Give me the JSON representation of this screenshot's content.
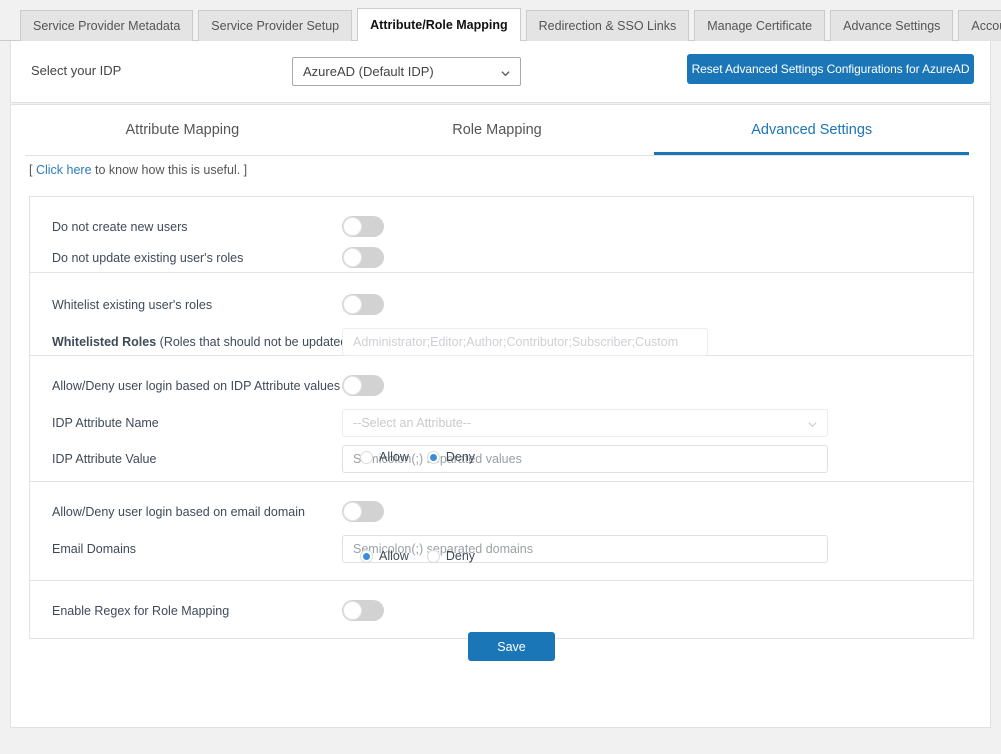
{
  "top_tabs": [
    {
      "label": "Service Provider Metadata",
      "active": false
    },
    {
      "label": "Service Provider Setup",
      "active": false
    },
    {
      "label": "Attribute/Role Mapping",
      "active": true
    },
    {
      "label": "Redirection & SSO Links",
      "active": false
    },
    {
      "label": "Manage Certificate",
      "active": false
    },
    {
      "label": "Advance Settings",
      "active": false
    },
    {
      "label": "Account Info",
      "active": false
    }
  ],
  "idp_bar": {
    "label": "Select your IDP",
    "selected_idp": "AzureAD (Default IDP)",
    "reset_button": "Reset Advanced Settings Configurations for AzureAD"
  },
  "sub_tabs": [
    {
      "label": "Attribute Mapping",
      "active": false
    },
    {
      "label": "Role Mapping",
      "active": false
    },
    {
      "label": "Advanced Settings",
      "active": true
    }
  ],
  "hint": {
    "open_bracket": "[ ",
    "link": "Click here",
    "rest": " to know how this is useful. ]"
  },
  "sections": {
    "users": {
      "create_label": "Do not create new users",
      "create_toggle": "off",
      "update_label": "Do not update existing user's roles",
      "update_toggle": "off"
    },
    "whitelist": {
      "toggle_label": "Whitelist existing user's roles",
      "toggle": "off",
      "roles_label_bold": "Whitelisted Roles",
      "roles_label_rest": " (Roles that should not be updated)",
      "roles_placeholder": "Administrator;Editor;Author;Contributor;Subscriber;Custom",
      "roles_value": ""
    },
    "idp_attribute": {
      "toggle_label": "Allow/Deny user login based on IDP Attribute values",
      "toggle": "off",
      "name_label": "IDP Attribute Name",
      "name_selected": "--Select an Attribute--",
      "value_label": "IDP Attribute Value",
      "value_placeholder": "Semicolon(;) separated values",
      "value_value": "",
      "radio_allow": "Allow",
      "radio_deny": "Deny",
      "selected_radio": "Deny"
    },
    "email_domain": {
      "toggle_label": "Allow/Deny user login based on email domain",
      "toggle": "off",
      "domains_label": "Email Domains",
      "domains_placeholder": "Semicolon(;) separated domains",
      "domains_value": "",
      "radio_allow": "Allow",
      "radio_deny": "Deny",
      "selected_radio": "Allow"
    },
    "regex": {
      "toggle_label": "Enable Regex for Role Mapping",
      "toggle": "off"
    }
  },
  "save_button": "Save",
  "colors": {
    "accent_blue": "#1b76b8",
    "link_blue": "#2b7cc0",
    "radio_blue": "#3c8cdc",
    "toggle_off": "#d2d2d2",
    "page_bg": "#f1f1f1"
  }
}
